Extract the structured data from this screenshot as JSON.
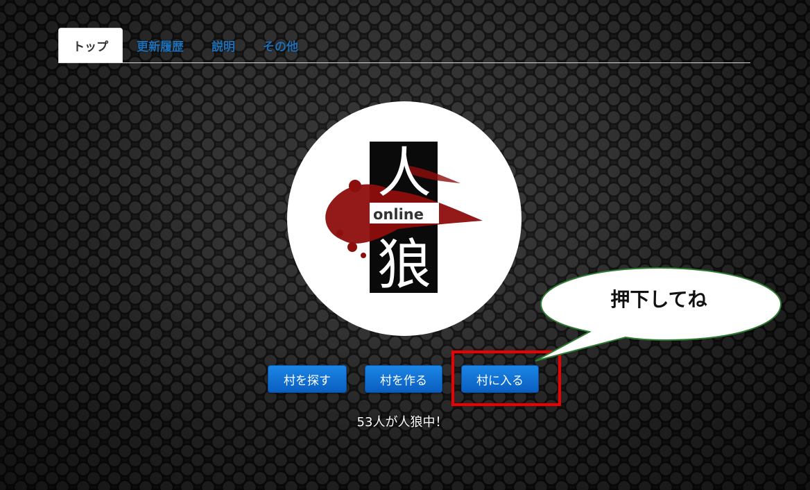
{
  "nav": {
    "tabs": [
      {
        "label": "トップ",
        "active": true
      },
      {
        "label": "更新履歴",
        "active": false
      },
      {
        "label": "説明",
        "active": false
      },
      {
        "label": "その他",
        "active": false
      }
    ]
  },
  "logo": {
    "kanji_top": "人",
    "kanji_bottom": "狼",
    "word": "online"
  },
  "actions": {
    "search_label": "村を探す",
    "create_label": "村を作る",
    "enter_label": "村に入る"
  },
  "annotation": {
    "callout_text": "押下してね",
    "highlight_color": "#ee0000"
  },
  "status": {
    "players_text": "53人が人狼中！"
  },
  "colors": {
    "button_blue": "#0a6fd6",
    "tab_link": "#1f6fb6"
  }
}
